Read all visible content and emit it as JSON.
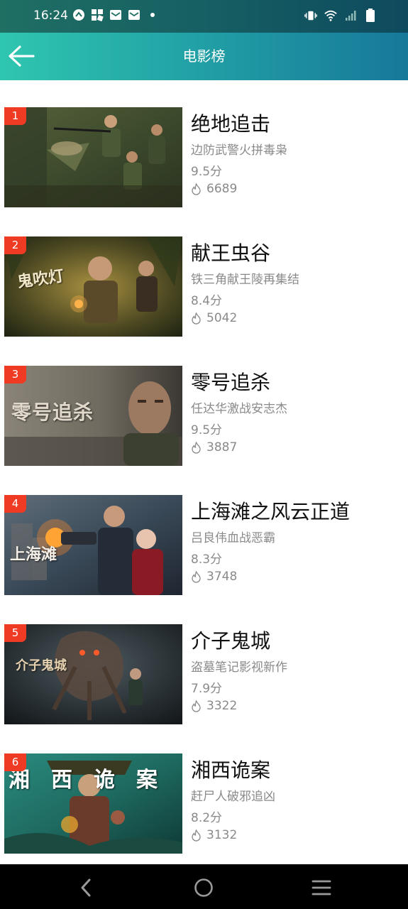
{
  "status_bar": {
    "time": "16:24",
    "left_icons": [
      "motorcycle-icon",
      "grid-apps-icon",
      "mail-icon",
      "mail-icon",
      "dot-icon"
    ],
    "right_icons": [
      "vibrate-icon",
      "wifi-icon",
      "signal-icon",
      "battery-icon"
    ]
  },
  "header": {
    "title": "电影榜",
    "back_icon": "arrow-left-icon",
    "gradient_start": "#2fc6b0",
    "gradient_end": "#17789a"
  },
  "movies": [
    {
      "rank": "1",
      "title": "绝地追击",
      "desc": "边防武警火拼毒枭",
      "score": "9.5分",
      "heat": "6689",
      "poster_text": ""
    },
    {
      "rank": "2",
      "title": "献王虫谷",
      "desc": "铁三角献王陵再集结",
      "score": "8.4分",
      "heat": "5042",
      "poster_text": "鬼吹灯"
    },
    {
      "rank": "3",
      "title": "零号追杀",
      "desc": "任达华激战安志杰",
      "score": "9.5分",
      "heat": "3887",
      "poster_text": "零号追杀"
    },
    {
      "rank": "4",
      "title": "上海滩之风云正道",
      "desc": "吕良伟血战恶霸",
      "score": "8.3分",
      "heat": "3748",
      "poster_text": "上海滩"
    },
    {
      "rank": "5",
      "title": "介子鬼城",
      "desc": "盗墓笔记影视新作",
      "score": "7.9分",
      "heat": "3322",
      "poster_text": "介子鬼城"
    },
    {
      "rank": "6",
      "title": "湘西诡案",
      "desc": "赶尸人破邪追凶",
      "score": "8.2分",
      "heat": "3132",
      "poster_text": "湘西诡案"
    }
  ],
  "heat_icon": "flame-icon",
  "badge_color": "#ef3b24",
  "nav_bar": {
    "icons": [
      "back-triangle-icon",
      "home-circle-icon",
      "menu-lines-icon"
    ]
  }
}
